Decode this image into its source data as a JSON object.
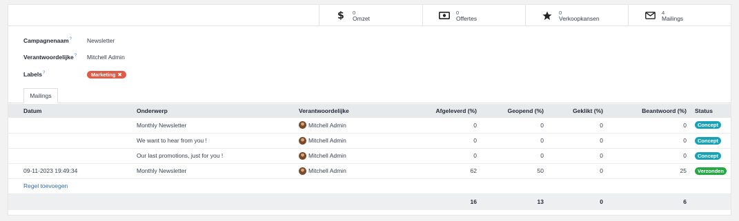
{
  "smart_buttons": [
    {
      "icon": "dollar-icon",
      "value": "0",
      "label": "Omzet"
    },
    {
      "icon": "money-bill-icon",
      "value": "0",
      "label": "Offertes"
    },
    {
      "icon": "star-icon",
      "value": "0",
      "label": "Verkoopkansen"
    },
    {
      "icon": "envelope-icon",
      "value": "4",
      "label": "Mailings"
    }
  ],
  "form": {
    "campaign_label": "Campagnenaam",
    "campaign_value": "Newsletter",
    "responsible_label": "Verantwoordelijke",
    "responsible_value": "Mitchell Admin",
    "labels_label": "Labels",
    "help_mark": "?",
    "tags": [
      {
        "label": "Marketing",
        "color": "#e05a48"
      }
    ]
  },
  "tabs": [
    {
      "label": "Mailings"
    }
  ],
  "table": {
    "headers": [
      "Datum",
      "Onderwerp",
      "Verantwoordelijke",
      "Afgeleverd (%)",
      "Geopend (%)",
      "Geklikt (%)",
      "Beantwoord (%)",
      "Status"
    ],
    "rows": [
      {
        "date": "",
        "subject": "Monthly Newsletter",
        "responsible": "Mitchell Admin",
        "delivered": "0",
        "opened": "0",
        "clicked": "0",
        "replied": "0",
        "status": "Concept",
        "status_color": "#17a2b8"
      },
      {
        "date": "",
        "subject": "We want to hear from you !",
        "responsible": "Mitchell Admin",
        "delivered": "0",
        "opened": "0",
        "clicked": "0",
        "replied": "0",
        "status": "Concept",
        "status_color": "#17a2b8"
      },
      {
        "date": "",
        "subject": "Our last promotions, just for you !",
        "responsible": "Mitchell Admin",
        "delivered": "0",
        "opened": "0",
        "clicked": "0",
        "replied": "0",
        "status": "Concept",
        "status_color": "#17a2b8"
      },
      {
        "date": "09-11-2023 19:49:34",
        "subject": "Monthly Newsletter",
        "responsible": "Mitchell Admin",
        "delivered": "62",
        "opened": "50",
        "clicked": "0",
        "replied": "25",
        "status": "Verzonden",
        "status_color": "#28a745"
      }
    ],
    "add_line": "Regel toevoegen",
    "totals": {
      "delivered": "16",
      "opened": "13",
      "clicked": "0",
      "replied": "6"
    }
  }
}
